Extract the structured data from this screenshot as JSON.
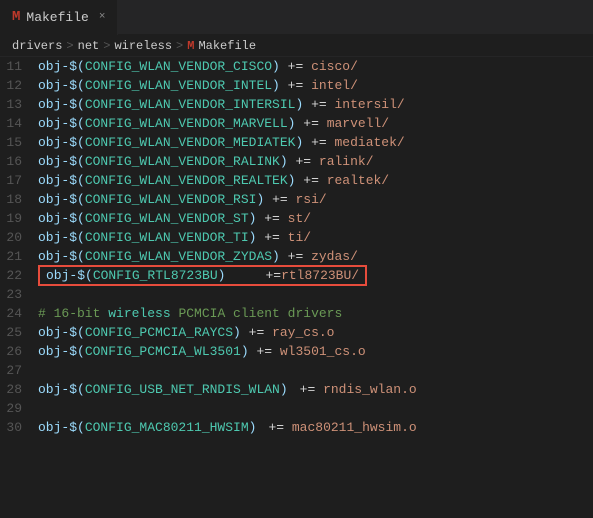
{
  "tab": {
    "icon": "M",
    "label": "Makefile",
    "close": "×"
  },
  "breadcrumb": {
    "parts": [
      "drivers",
      "net",
      "wireless",
      "Makefile"
    ],
    "icon": "M"
  },
  "lines": [
    {
      "num": 11,
      "content": "obj-$(CONFIG_WLAN_VENDOR_CISCO) += cisco/",
      "type": "normal"
    },
    {
      "num": 12,
      "content": "obj-$(CONFIG_WLAN_VENDOR_INTEL) += intel/",
      "type": "normal"
    },
    {
      "num": 13,
      "content": "obj-$(CONFIG_WLAN_VENDOR_INTERSIL) += intersil/",
      "type": "normal"
    },
    {
      "num": 14,
      "content": "obj-$(CONFIG_WLAN_VENDOR_MARVELL) += marvell/",
      "type": "normal"
    },
    {
      "num": 15,
      "content": "obj-$(CONFIG_WLAN_VENDOR_MEDIATEK) += mediatek/",
      "type": "normal"
    },
    {
      "num": 16,
      "content": "obj-$(CONFIG_WLAN_VENDOR_RALINK) += ralink/",
      "type": "normal"
    },
    {
      "num": 17,
      "content": "obj-$(CONFIG_WLAN_VENDOR_REALTEK) += realtek/",
      "type": "normal"
    },
    {
      "num": 18,
      "content": "obj-$(CONFIG_WLAN_VENDOR_RSI) += rsi/",
      "type": "normal"
    },
    {
      "num": 19,
      "content": "obj-$(CONFIG_WLAN_VENDOR_ST) += st/",
      "type": "normal"
    },
    {
      "num": 20,
      "content": "obj-$(CONFIG_WLAN_VENDOR_TI) += ti/",
      "type": "normal"
    },
    {
      "num": 21,
      "content": "obj-$(CONFIG_WLAN_VENDOR_ZYDAS) += zydas/",
      "type": "normal"
    },
    {
      "num": 22,
      "content": "obj-$(CONFIG_RTL8723BU)\t\t+= rtl8723BU/",
      "type": "highlighted"
    },
    {
      "num": 23,
      "content": "",
      "type": "empty"
    },
    {
      "num": 24,
      "content": "# 16-bit wireless PCMCIA client drivers",
      "type": "comment"
    },
    {
      "num": 25,
      "content": "obj-$(CONFIG_PCMCIA_RAYCS) += ray_cs.o",
      "type": "normal"
    },
    {
      "num": 26,
      "content": "obj-$(CONFIG_PCMCIA_WL3501) += wl3501_cs.o",
      "type": "normal"
    },
    {
      "num": 27,
      "content": "",
      "type": "empty"
    },
    {
      "num": 28,
      "content": "obj-$(CONFIG_USB_NET_RNDIS_WLAN)\t+= rndis_wlan.o",
      "type": "normal"
    },
    {
      "num": 29,
      "content": "",
      "type": "empty"
    },
    {
      "num": 30,
      "content": "obj-$(CONFIG_MAC80211_HWSIM)\t+= mac80211_hwsim.o",
      "type": "normal"
    }
  ]
}
